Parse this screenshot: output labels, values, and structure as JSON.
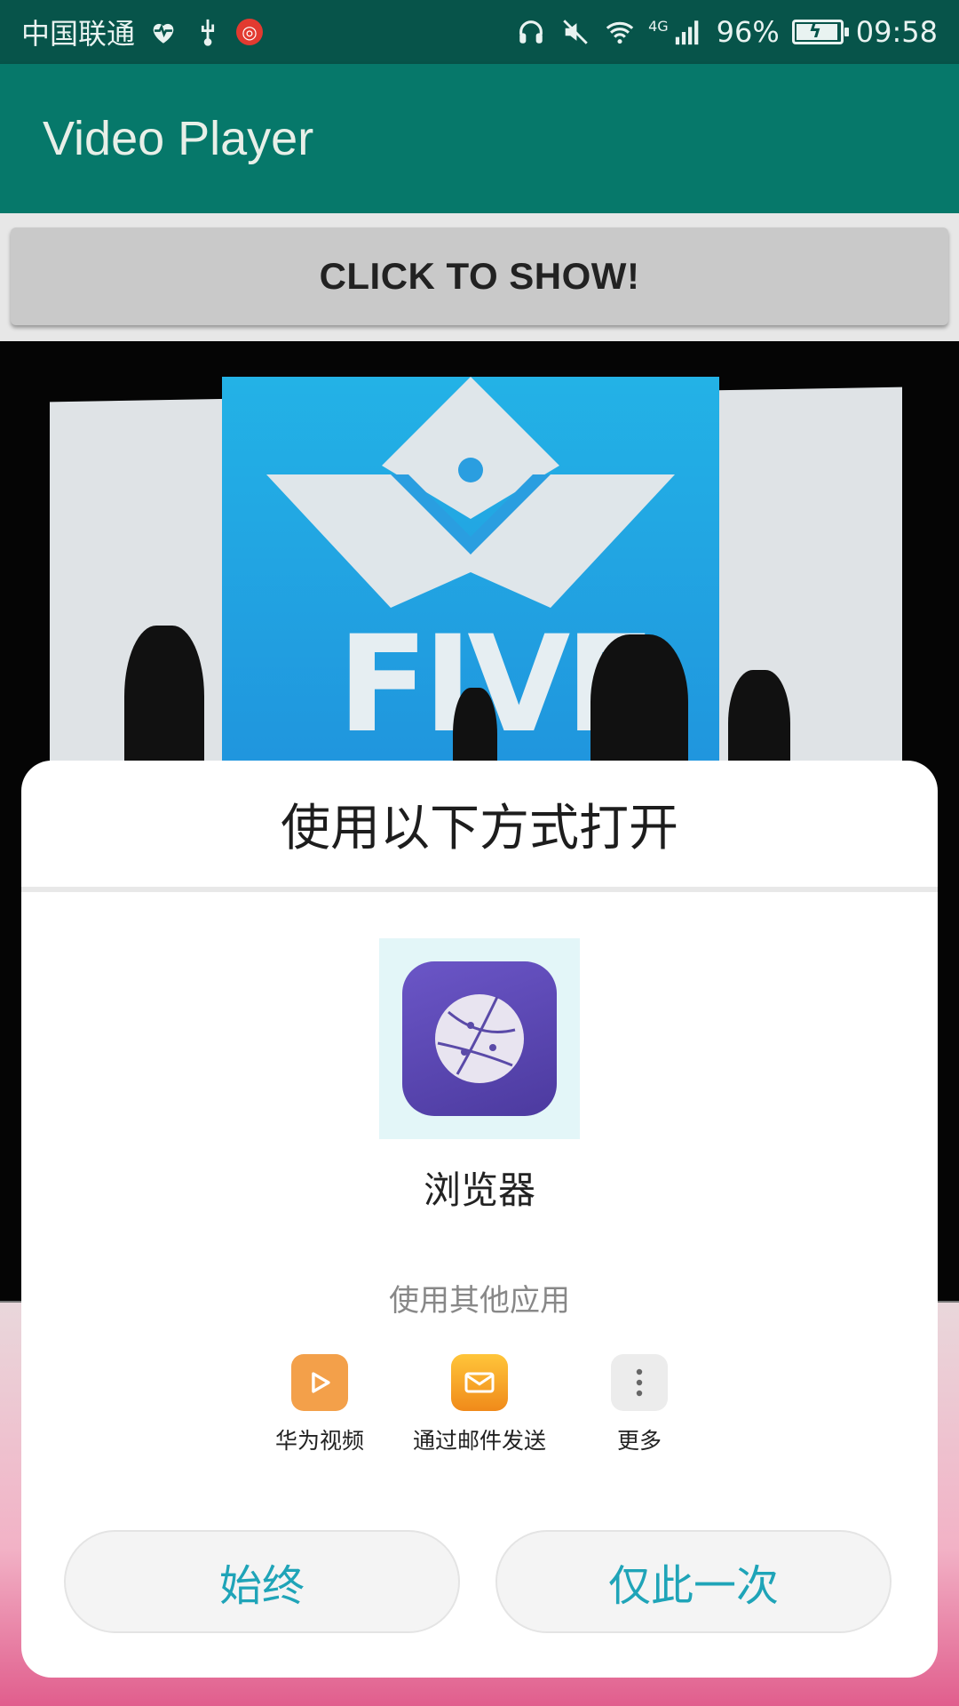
{
  "status_bar": {
    "carrier": "中国联通",
    "battery_percent": "96%",
    "time": "09:58",
    "network": "4G",
    "left_icons": [
      "heartbeat-icon",
      "usb-icon",
      "netease-music-icon"
    ],
    "right_icons": [
      "headphones-icon",
      "mute-icon",
      "wifi-icon",
      "signal-icon",
      "battery-charging-icon"
    ]
  },
  "app_bar": {
    "title": "Video Player"
  },
  "show_button": {
    "label": "CLICK TO SHOW!"
  },
  "video": {
    "logo_text": "FIVE"
  },
  "dialog": {
    "title": "使用以下方式打开",
    "primary_app": {
      "label": "浏览器",
      "icon": "browser-icon"
    },
    "other_apps_label": "使用其他应用",
    "other_apps": [
      {
        "label": "华为视频",
        "icon": "huawei-video-icon"
      },
      {
        "label": "通过邮件发送",
        "icon": "email-icon"
      },
      {
        "label": "更多",
        "icon": "more-icon"
      }
    ],
    "always_label": "始终",
    "once_label": "仅此一次"
  },
  "colors": {
    "status_bar": "#07544a",
    "app_bar": "#06786a",
    "accent_text": "#1fa4b8"
  }
}
